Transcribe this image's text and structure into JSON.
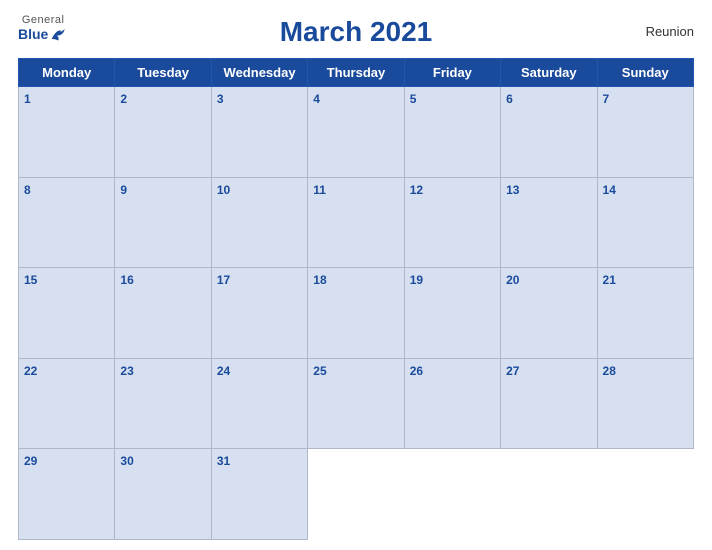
{
  "header": {
    "title": "March 2021",
    "region": "Reunion",
    "logo": {
      "general": "General",
      "blue": "Blue"
    }
  },
  "weekdays": [
    "Monday",
    "Tuesday",
    "Wednesday",
    "Thursday",
    "Friday",
    "Saturday",
    "Sunday"
  ],
  "weeks": [
    [
      1,
      2,
      3,
      4,
      5,
      6,
      7
    ],
    [
      8,
      9,
      10,
      11,
      12,
      13,
      14
    ],
    [
      15,
      16,
      17,
      18,
      19,
      20,
      21
    ],
    [
      22,
      23,
      24,
      25,
      26,
      27,
      28
    ],
    [
      29,
      30,
      31,
      null,
      null,
      null,
      null
    ]
  ]
}
